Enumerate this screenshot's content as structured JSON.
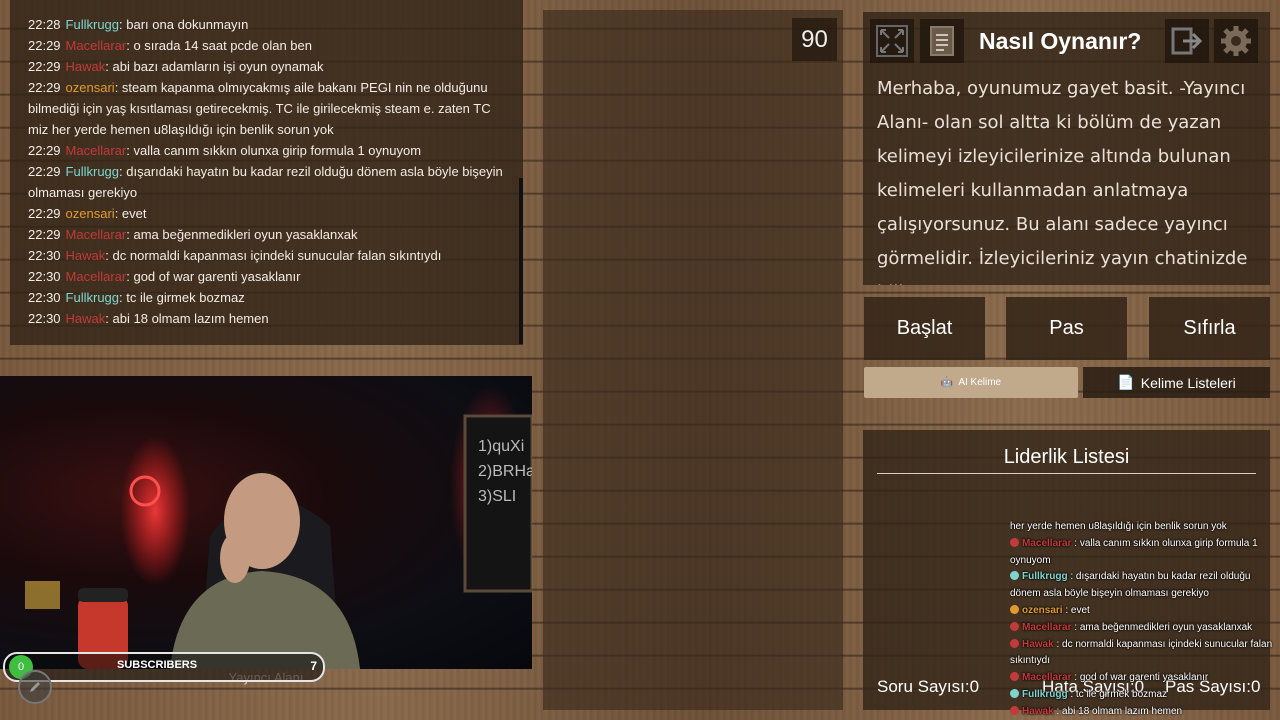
{
  "chat": {
    "lines": [
      {
        "time": "22:28",
        "user": "Fullkrugg",
        "color": "#7dd6d0",
        "msg": "barı ona dokunmayın"
      },
      {
        "time": "22:29",
        "user": "Macellarar",
        "color": "#c23a3a",
        "msg": "o sırada 14 saat pcde olan ben"
      },
      {
        "time": "22:29",
        "user": "Hawak",
        "color": "#c23a3a",
        "msg": "abi bazı adamların işi oyun oynamak"
      },
      {
        "time": "22:29",
        "user": "ozensari",
        "color": "#e09b2c",
        "msg": "steam kapanma olmıycakmış aile bakanı PEGI nin ne olduğunu bilmediği için yaş kısıtlaması getirecekmiş. TC ile girilecekmiş steam e. zaten TC miz her yerde hemen u8laşıldığı için benlik sorun yok"
      },
      {
        "time": "22:29",
        "user": "Macellarar",
        "color": "#c23a3a",
        "msg": "valla canım sıkkın olunxa girip formula 1 oynuyom"
      },
      {
        "time": "22:29",
        "user": "Fullkrugg",
        "color": "#7dd6d0",
        "msg": "dışarıdaki hayatın bu kadar rezil olduğu dönem asla böyle bişeyin olmaması gerekiyo"
      },
      {
        "time": "22:29",
        "user": "ozensari",
        "color": "#e09b2c",
        "msg": "evet"
      },
      {
        "time": "22:29",
        "user": "Macellarar",
        "color": "#c23a3a",
        "msg": "ama beğenmedikleri oyun yasaklanxak"
      },
      {
        "time": "22:30",
        "user": "Hawak",
        "color": "#c23a3a",
        "msg": "dc normaldi kapanması içindeki sunucular falan sıkıntıydı"
      },
      {
        "time": "22:30",
        "user": "Macellarar",
        "color": "#c23a3a",
        "msg": "god of war garenti yasaklanır"
      },
      {
        "time": "22:30",
        "user": "Fullkrugg",
        "color": "#7dd6d0",
        "msg": "tc ile girmek bozmaz"
      },
      {
        "time": "22:30",
        "user": "Hawak",
        "color": "#c23a3a",
        "msg": "abi 18 olmam lazım hemen"
      }
    ]
  },
  "timer": {
    "value": "90"
  },
  "howto": {
    "title": "Nasıl Oynanır?",
    "text": "Merhaba, oyunumuz gayet basit. -Yayıncı Alanı- olan sol altta ki bölüm de yazan kelimeyi izleyicilerinize altında bulunan kelimeleri kullanmadan anlatmaya çalışıyorsunuz. Bu alanı sadece yayıncı görmelidir. İzleyicileriniz yayın chatinizde bili..."
  },
  "controls": {
    "start": "Başlat",
    "pass": "Pas",
    "reset": "Sıfırla"
  },
  "tabs": {
    "ai": "AI Kelime",
    "lists": "Kelime Listeleri"
  },
  "leaderboard": {
    "title": "Liderlik Listesi"
  },
  "overlay_chat": {
    "lines": [
      {
        "user": "",
        "color": "#fff",
        "msg": "her yerde hemen u8laşıldığı için benlik sorun yok"
      },
      {
        "user": "Macellarar",
        "color": "#c23a3a",
        "msg": "valla canım sıkkın olunxa girip formula 1 oynuyom"
      },
      {
        "user": "Fullkrugg",
        "color": "#7dd6d0",
        "msg": "dışarıdaki hayatın bu kadar rezil olduğu dönem asla böyle bişeyin olmaması gerekiyo"
      },
      {
        "user": "ozensari",
        "color": "#e09b2c",
        "msg": "evet"
      },
      {
        "user": "Macellarar",
        "color": "#c23a3a",
        "msg": "ama beğenmedikleri oyun yasaklanxak"
      },
      {
        "user": "Hawak",
        "color": "#c23a3a",
        "msg": "dc normaldi kapanması içindeki sunucular falan sıkıntıydı"
      },
      {
        "user": "Macellarar",
        "color": "#c23a3a",
        "msg": "god of war garenti yasaklanır"
      },
      {
        "user": "Fullkrugg",
        "color": "#7dd6d0",
        "msg": "tc ile girmek bozmaz"
      },
      {
        "user": "Hawak",
        "color": "#c23a3a",
        "msg": "abi 18 olmam lazım hemen"
      }
    ]
  },
  "stats": {
    "questions": "Soru Sayısı:0",
    "errors": "Hata Sayısı:0",
    "passes": "Pas Sayısı:0"
  },
  "webcam": {
    "label": "Yayıncı Alanı"
  },
  "subscribers": {
    "left": "0",
    "label": "SUBSCRIBERS",
    "right": "7"
  },
  "icons": {
    "fullscreen": "fullscreen-icon",
    "notes": "notes-icon",
    "exit": "exit-icon",
    "settings": "gear-icon",
    "edit": "pencil-icon"
  }
}
